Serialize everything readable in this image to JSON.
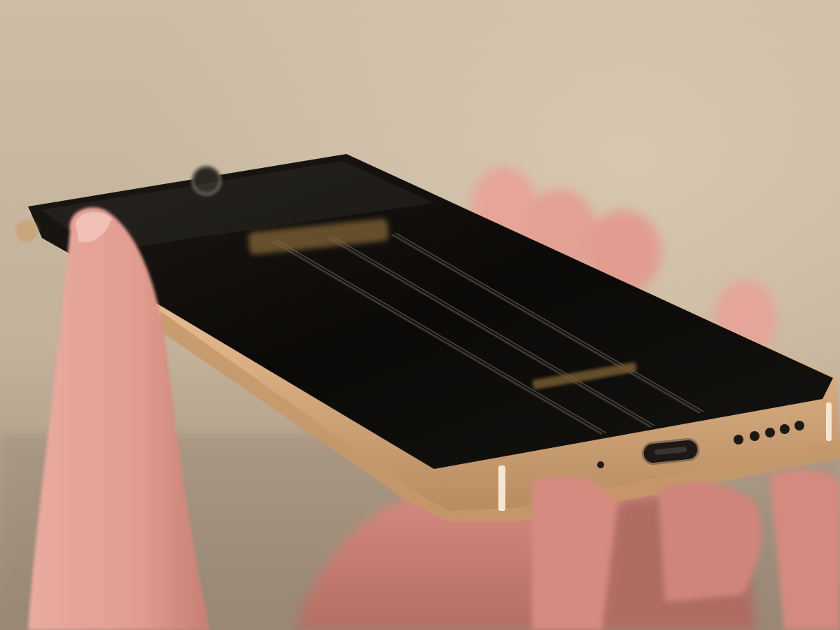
{
  "photo": {
    "subject": "smartphone-held-in-hand",
    "colors": {
      "background_top": "#cdbda7",
      "background_mid": "#c3b29a",
      "background_bottom": "#9d8b78",
      "phone_back": "#0e0c0a",
      "phone_frame_gold": "#e2b98f",
      "frame_highlight": "#f3d7b4",
      "logo_gold": "#8a6a3a",
      "skin": "#e7a59a",
      "skin_shadow": "#c77f73"
    },
    "visible_parts": [
      "usb-c-port",
      "speaker-grille",
      "microphone-hole",
      "antenna-lines",
      "camera-lens"
    ]
  }
}
